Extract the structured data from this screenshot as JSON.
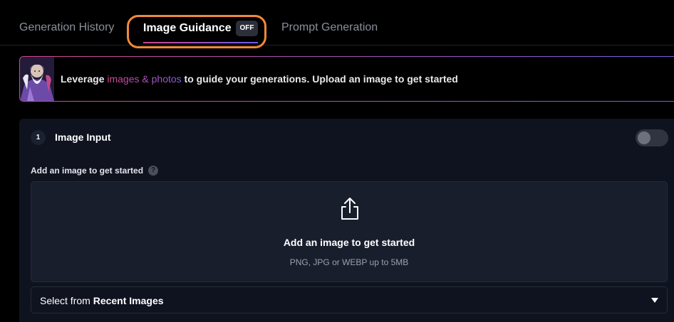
{
  "tabs": {
    "history_label": "Generation History",
    "guidance_label": "Image Guidance",
    "guidance_badge": "OFF",
    "prompt_label": "Prompt Generation"
  },
  "banner": {
    "text_before": "Leverage ",
    "accent_text": "images & photos",
    "text_after": " to guide your generations. Upload an image to get started"
  },
  "panel": {
    "step_number": "1",
    "title": "Image Input",
    "toggle_on": false,
    "add_label": "Add an image to get started",
    "help_icon": "?",
    "dropzone_icon": "upload-icon",
    "dropzone_title": "Add an image to get started",
    "dropzone_subtitle": "PNG, JPG or WEBP up to 5MB",
    "select_prefix": "Select from ",
    "select_emphasis": "Recent Images"
  },
  "colors": {
    "accent_pink": "#d14a8e",
    "accent_purple": "#7c5ce6",
    "highlight_orange": "#f08a3c"
  }
}
